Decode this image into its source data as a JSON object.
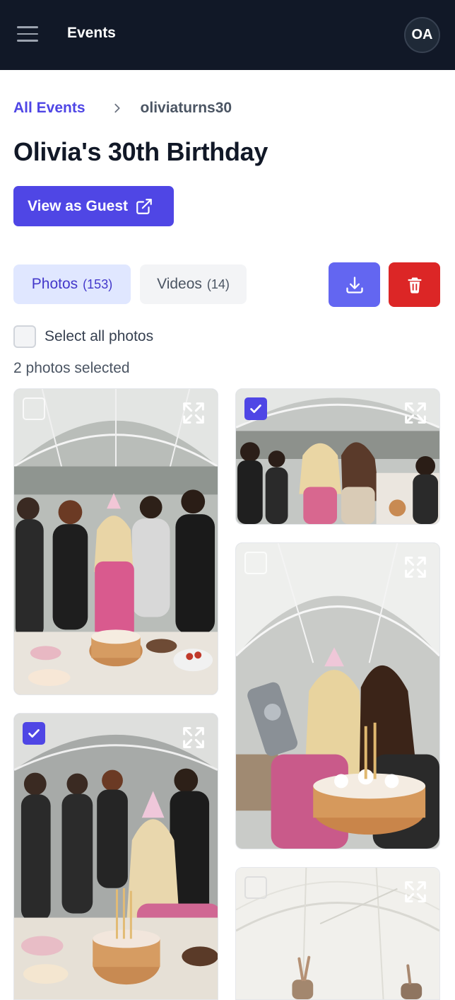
{
  "header": {
    "title": "Events",
    "avatar_initials": "OA",
    "menu_icon": "hamburger-menu-icon"
  },
  "breadcrumb": {
    "parent": "All Events",
    "separator_icon": "chevron-right-icon",
    "current": "oliviaturns30"
  },
  "page": {
    "title": "Olivia's 30th Birthday",
    "guest_button_label": "View as Guest",
    "guest_button_icon": "external-link-icon"
  },
  "tabs": [
    {
      "label": "Photos",
      "count": "(153)",
      "active": true
    },
    {
      "label": "Videos",
      "count": "(14)",
      "active": false
    }
  ],
  "actions": {
    "download_icon": "download-icon",
    "delete_icon": "trash-icon"
  },
  "selection": {
    "select_all_label": "Select all photos",
    "selected_text": "2 photos selected"
  },
  "photos": [
    {
      "subject": "group celebrating around birthday cake",
      "selected": false
    },
    {
      "subject": "friends laughing together under tent",
      "selected": true
    },
    {
      "subject": "selfie with birthday cake",
      "selected": false
    },
    {
      "subject": "blowing out birthday candles",
      "selected": true
    },
    {
      "subject": "tent ceiling with raised hands",
      "selected": false
    }
  ],
  "colors": {
    "header_bg": "#111827",
    "accent": "#4f46e5",
    "download_bg": "#6366f1",
    "delete_bg": "#dc2626",
    "tab_active_bg": "#e0e7ff",
    "tab_inactive_bg": "#f3f4f6"
  }
}
